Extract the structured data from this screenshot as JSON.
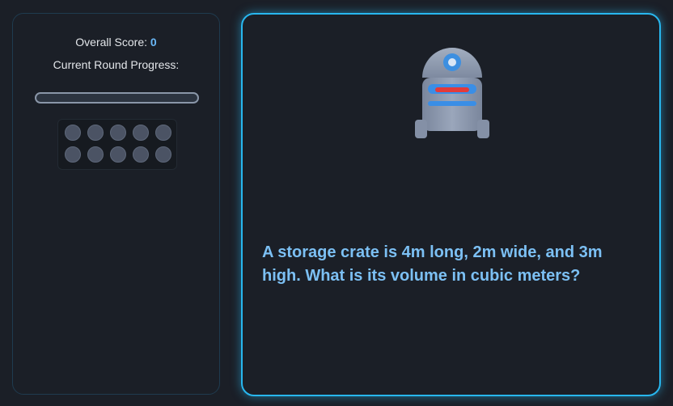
{
  "scoreboard": {
    "score_label": "Overall Score:",
    "score_value": "0",
    "progress_label": "Current Round Progress:",
    "round_progress": 0,
    "round_slots_total": 10,
    "round_slots_done": 0
  },
  "question": {
    "text": "A storage crate is 4m long, 2m wide, and 3m high. What is its volume in cubic meters?"
  },
  "colors": {
    "background": "#1b1f27",
    "accent": "#28b7ef",
    "question_text": "#7cc0f4",
    "score_value": "#6ab8f7",
    "robot_body": "#8c99b0",
    "robot_eye": "#3d8fe0",
    "robot_visor": "#3a8ee6",
    "robot_mouth": "#e23b3b"
  },
  "icons": {
    "mascot": "robot-icon"
  }
}
